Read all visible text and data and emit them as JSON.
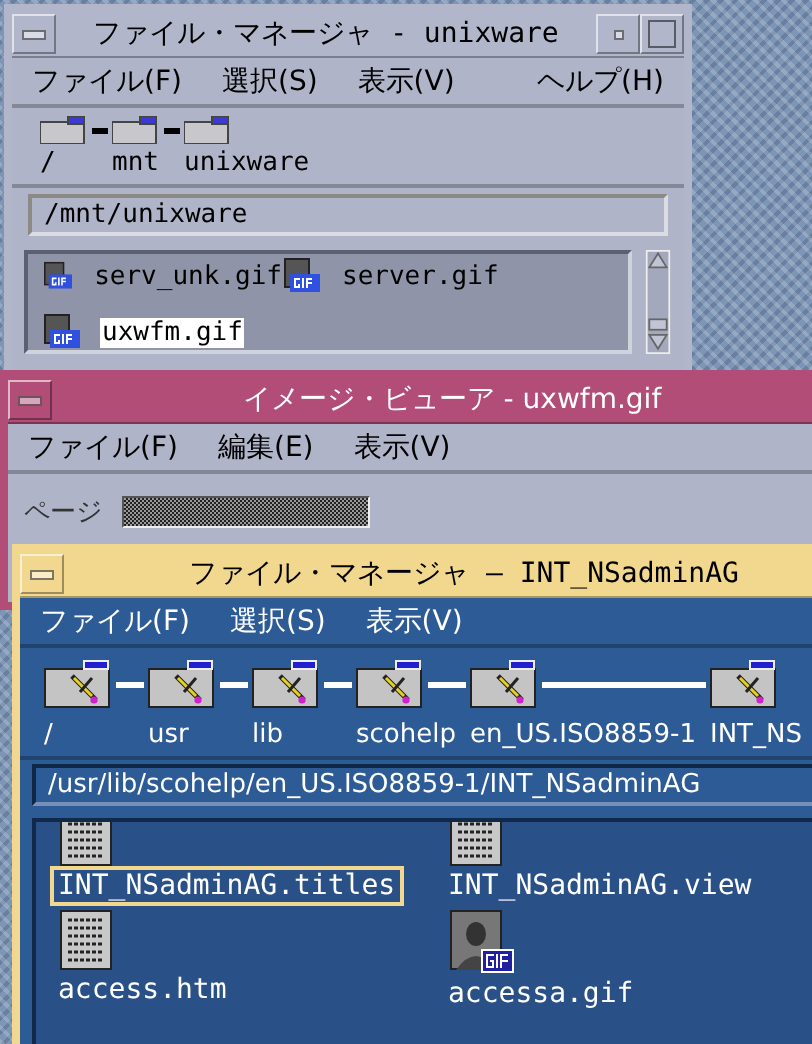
{
  "windows": [
    {
      "kind": "file_manager",
      "title": "ファイル・マネージャ - unixware",
      "color": "#b2b6ca",
      "dark": false,
      "menu": [
        {
          "label": "ファイル(F)"
        },
        {
          "label": "選択(S)"
        },
        {
          "label": "表示(V)"
        }
      ],
      "help_menu": "ヘルプ(H)",
      "path_segments": [
        "/",
        "mnt",
        "unixware"
      ],
      "path": "/mnt/unixware",
      "files": [
        {
          "name": "serv_unk.gif",
          "kind": "gif",
          "selected": false
        },
        {
          "name": "server.gif",
          "kind": "gif",
          "selected": false
        },
        {
          "name": "uxwfm.gif",
          "kind": "gif",
          "selected": true
        }
      ]
    },
    {
      "kind": "image_viewer",
      "title": "イメージ・ビューア - uxwfm.gif",
      "color": "#b14d76",
      "dark": false,
      "menu": [
        {
          "label": "ファイル(F)"
        },
        {
          "label": "編集(E)"
        },
        {
          "label": "表示(V)"
        }
      ],
      "page_label": "ページ"
    },
    {
      "kind": "file_manager",
      "title": "ファイル・マネージャ – INT_NSadminAG",
      "color": "#f2d88e",
      "dark": true,
      "menu": [
        {
          "label": "ファイル(F)"
        },
        {
          "label": "選択(S)"
        },
        {
          "label": "表示(V)"
        }
      ],
      "path_segments": [
        "/",
        "usr",
        "lib",
        "scohelp",
        "en_US.ISO8859-1",
        "INT_NS"
      ],
      "path": "/usr/lib/scohelp/en_US.ISO8859-1/INT_NSadminAG",
      "files": [
        {
          "name": "INT_NSadminAG.titles",
          "kind": "doc",
          "selected": true
        },
        {
          "name": "INT_NSadminAG.view",
          "kind": "doc",
          "selected": false
        },
        {
          "name": "access.htm",
          "kind": "doc",
          "selected": false
        },
        {
          "name": "accessa.gif",
          "kind": "picture",
          "selected": false
        }
      ]
    }
  ]
}
